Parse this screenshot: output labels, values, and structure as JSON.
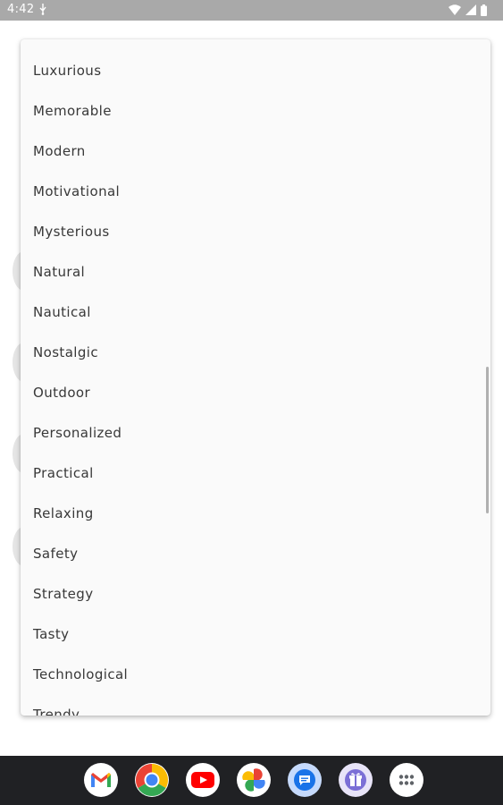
{
  "status_bar": {
    "time": "4:42"
  },
  "dropdown": {
    "options": [
      "Luxurious",
      "Memorable",
      "Modern",
      "Motivational",
      "Mysterious",
      "Natural",
      "Nautical",
      "Nostalgic",
      "Outdoor",
      "Personalized",
      "Practical",
      "Relaxing",
      "Safety",
      "Strategy",
      "Tasty",
      "Technological",
      "Trendy"
    ]
  },
  "dock": {
    "apps": [
      "gmail-icon",
      "chrome-icon",
      "youtube-icon",
      "photos-icon",
      "messages-icon",
      "gift-app-icon",
      "app-drawer-icon"
    ]
  },
  "colors": {
    "status_bar": "#a9a9a9",
    "menu_background": "#fafafa",
    "menu_text": "#383838",
    "nav_bar": "#202124"
  }
}
